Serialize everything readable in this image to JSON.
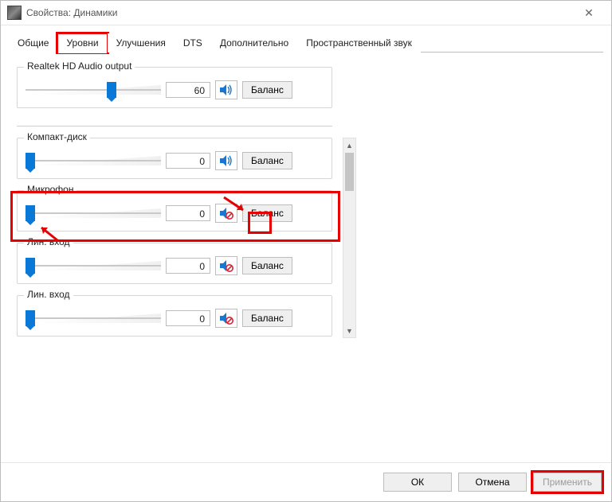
{
  "window": {
    "title": "Свойства: Динамики"
  },
  "tabs": {
    "items": [
      {
        "label": "Общие"
      },
      {
        "label": "Уровни"
      },
      {
        "label": "Улучшения"
      },
      {
        "label": "DTS"
      },
      {
        "label": "Дополнительно"
      },
      {
        "label": "Пространственный звук"
      }
    ],
    "active_index": 1
  },
  "levels": {
    "main": {
      "name": "Realtek HD Audio output",
      "value": "60",
      "slider_pct": 60,
      "muted": false,
      "balance_label": "Баланс"
    },
    "inputs": [
      {
        "name": "Компакт-диск",
        "value": "0",
        "slider_pct": 0,
        "muted": false,
        "balance_label": "Баланс"
      },
      {
        "name": "Микрофон",
        "value": "0",
        "slider_pct": 0,
        "muted": true,
        "balance_label": "Баланс",
        "highlighted": true
      },
      {
        "name": "Лин. вход",
        "value": "0",
        "slider_pct": 0,
        "muted": true,
        "balance_label": "Баланс"
      },
      {
        "name": "Лин. вход",
        "value": "0",
        "slider_pct": 0,
        "muted": true,
        "balance_label": "Баланс"
      }
    ]
  },
  "footer": {
    "ok": "ОК",
    "cancel": "Отмена",
    "apply": "Применить"
  }
}
